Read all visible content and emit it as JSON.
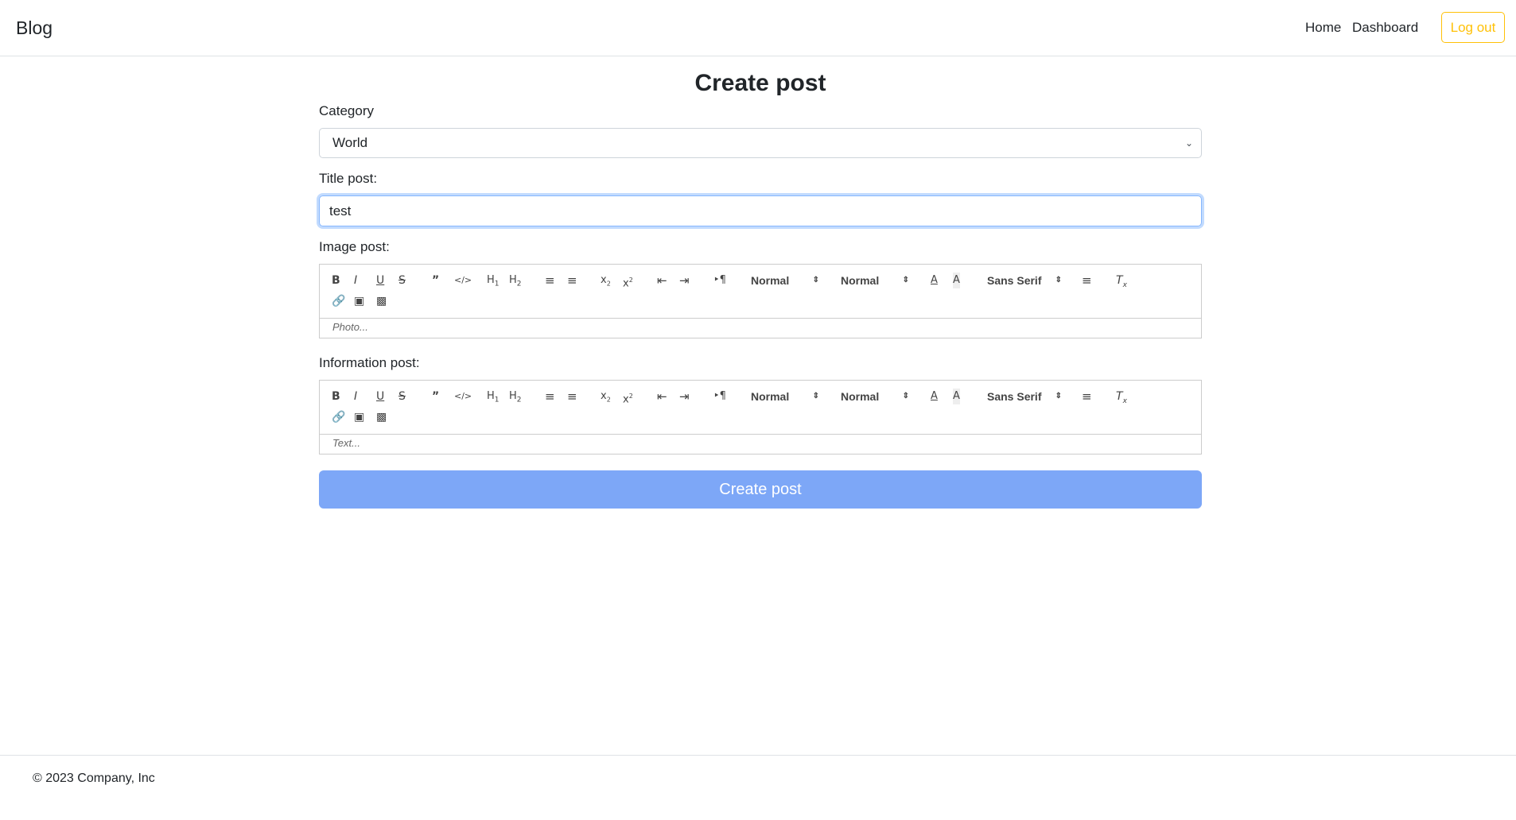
{
  "header": {
    "brand": "Blog",
    "nav": [
      "Home",
      "Dashboard"
    ],
    "logout_label": "Log out"
  },
  "page": {
    "title": "Create post"
  },
  "form": {
    "category_label": "Category",
    "category_value": "World",
    "title_label": "Title post:",
    "title_value": "test",
    "image_label": "Image post:",
    "image_placeholder": "Photo...",
    "info_label": "Information post:",
    "info_placeholder": "Text...",
    "submit_label": "Create post"
  },
  "toolbar": {
    "header_select": "Normal",
    "size_select": "Normal",
    "font_select": "Sans Serif",
    "icons": [
      "bold-icon",
      "italic-icon",
      "underline-icon",
      "strike-icon",
      "blockquote-icon",
      "code-block-icon",
      "h1-icon",
      "h2-icon",
      "ordered-list-icon",
      "bullet-list-icon",
      "subscript-icon",
      "superscript-icon",
      "outdent-icon",
      "indent-icon",
      "rtl-direction-icon",
      "text-color-icon",
      "background-color-icon",
      "align-icon",
      "clear-format-icon",
      "link-icon",
      "image-icon",
      "video-icon"
    ]
  },
  "footer": {
    "copyright": "© 2023 Company, Inc"
  },
  "colors": {
    "primary_button": "#7da7f7",
    "logout_outline": "#ffc107",
    "focus_border": "#86b7fe"
  }
}
